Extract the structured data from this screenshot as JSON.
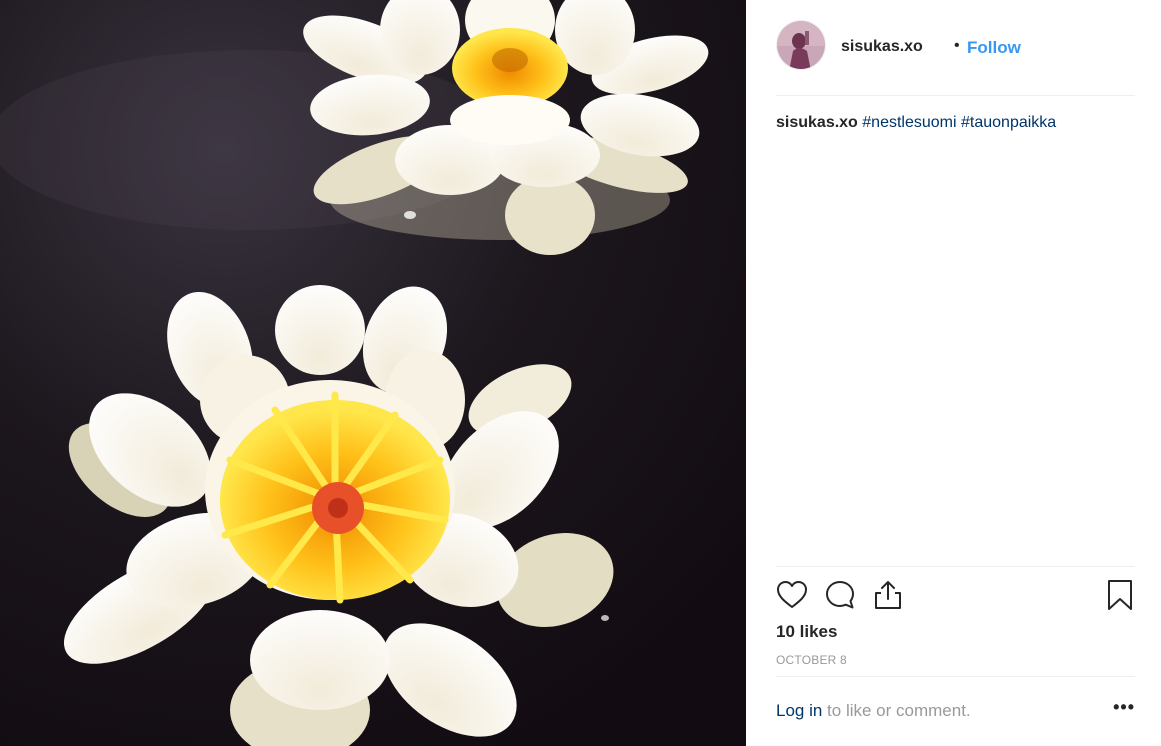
{
  "post": {
    "username": "sisukas.xo",
    "separator": "•",
    "follow_label": "Follow",
    "image_alt": "",
    "caption": {
      "username": "sisukas.xo",
      "hashtags": [
        "#nestlesuomi",
        "#tauonpaikka"
      ]
    },
    "likes_text": "10 likes",
    "date": "OCTOBER 8",
    "comment_prompt": {
      "login_label": "Log in",
      "rest_text": " to like or comment."
    },
    "more_label": "•••"
  },
  "icons": {
    "like": "heart-icon",
    "comment": "speech-bubble-icon",
    "share": "share-icon",
    "save": "bookmark-icon"
  },
  "colors": {
    "link_blue": "#3897f0",
    "hashtag": "#003569",
    "muted": "#999999",
    "divider": "#efefef"
  }
}
